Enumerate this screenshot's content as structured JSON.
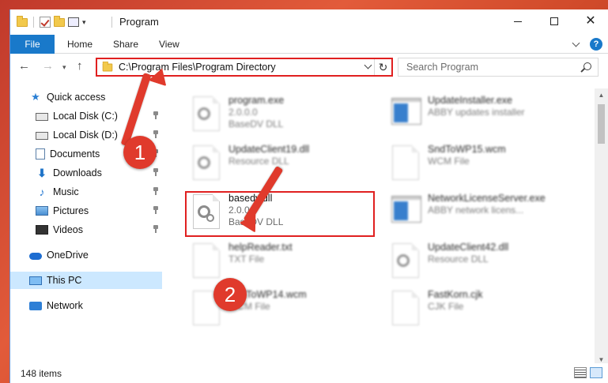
{
  "window": {
    "title": "Program",
    "colors": {
      "accent": "#1979ca",
      "highlight": "#e02020",
      "selected": "#cce8ff"
    }
  },
  "ribbon": {
    "tabs": [
      {
        "label": "File"
      },
      {
        "label": "Home"
      },
      {
        "label": "Share"
      },
      {
        "label": "View"
      }
    ],
    "help": "?"
  },
  "nav": {
    "address": "C:\\Program Files\\Program Directory",
    "search_placeholder": "Search Program"
  },
  "sidebar": {
    "items": [
      {
        "label": "Quick access",
        "icon": "star-icon"
      },
      {
        "label": "Local Disk (C:)",
        "icon": "drive-icon",
        "pinned": true
      },
      {
        "label": "Local Disk (D:)",
        "icon": "drive-icon",
        "pinned": true
      },
      {
        "label": "Documents",
        "icon": "documents-icon",
        "pinned": true
      },
      {
        "label": "Downloads",
        "icon": "downloads-icon",
        "pinned": true
      },
      {
        "label": "Music",
        "icon": "music-icon",
        "pinned": true
      },
      {
        "label": "Pictures",
        "icon": "pictures-icon",
        "pinned": true
      },
      {
        "label": "Videos",
        "icon": "videos-icon",
        "pinned": true
      },
      {
        "label": "OneDrive",
        "icon": "onedrive-icon"
      },
      {
        "label": "This PC",
        "icon": "pc-icon",
        "selected": true
      },
      {
        "label": "Network",
        "icon": "network-icon"
      }
    ]
  },
  "files": [
    {
      "name": "program.exe",
      "line2": "2.0.0.0",
      "line3": "BaseDV DLL",
      "icon": "exe-icon"
    },
    {
      "name": "UpdateInstaller.exe",
      "line2": "ABBY updates installer",
      "line3": "",
      "icon": "window-icon"
    },
    {
      "name": "UpdateClient19.dll",
      "line2": "Resource DLL",
      "line3": "",
      "icon": "dll-icon"
    },
    {
      "name": "SndToWP15.wcm",
      "line2": "WCM File",
      "line3": "",
      "icon": "file-icon"
    },
    {
      "name": "basedv.dll",
      "line2": "2.0.0.0",
      "line3": "BaseDV DLL",
      "icon": "dll-icon"
    },
    {
      "name": "NetworkLicenseServer.exe",
      "line2": "ABBY network licens...",
      "line3": "",
      "icon": "window-icon"
    },
    {
      "name": "helpReader.txt",
      "line2": "TXT File",
      "line3": "",
      "icon": "file-icon"
    },
    {
      "name": "UpdateClient42.dll",
      "line2": "Resource DLL",
      "line3": "",
      "icon": "dll-icon"
    },
    {
      "name": "SndToWP14.wcm",
      "line2": "WCM File",
      "line3": "",
      "icon": "file-icon"
    },
    {
      "name": "FastKorn.cjk",
      "line2": "CJK File",
      "line3": "",
      "icon": "file-icon"
    }
  ],
  "status": {
    "items": "148 items"
  },
  "callouts": [
    "1",
    "2"
  ]
}
